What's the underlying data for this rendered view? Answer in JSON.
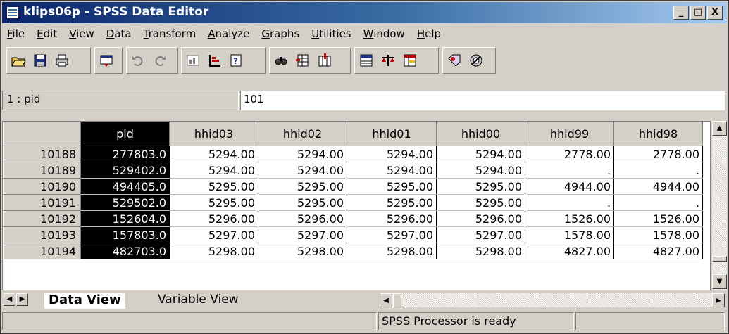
{
  "window": {
    "title": "klips06p - SPSS Data Editor",
    "controls": {
      "minimize": "_",
      "maximize": "□",
      "close": "X"
    }
  },
  "menu": [
    {
      "label": "File",
      "accel": "F",
      "rest": "ile"
    },
    {
      "label": "Edit",
      "accel": "E",
      "rest": "dit"
    },
    {
      "label": "View",
      "accel": "V",
      "rest": "iew"
    },
    {
      "label": "Data",
      "accel": "D",
      "rest": "ata"
    },
    {
      "label": "Transform",
      "accel": "T",
      "rest": "ransform"
    },
    {
      "label": "Analyze",
      "accel": "A",
      "rest": "nalyze"
    },
    {
      "label": "Graphs",
      "accel": "G",
      "rest": "raphs"
    },
    {
      "label": "Utilities",
      "accel": "U",
      "rest": "tilities"
    },
    {
      "label": "Window",
      "accel": "W",
      "rest": "indow"
    },
    {
      "label": "Help",
      "accel": "H",
      "rest": "elp"
    }
  ],
  "toolbar": {
    "icons": [
      "open-icon",
      "save-icon",
      "print-icon",
      "dialog-recall-icon",
      "undo-icon",
      "redo-icon",
      "goto-chart-icon",
      "goto-case-icon",
      "variables-icon",
      "find-icon",
      "insert-case-icon",
      "insert-variable-icon",
      "split-file-icon",
      "weight-cases-icon",
      "select-cases-icon",
      "value-labels-icon",
      "use-sets-icon"
    ]
  },
  "cell_editor": {
    "reference": "1 : pid",
    "value": "101"
  },
  "grid": {
    "columns": [
      "pid",
      "hhid03",
      "hhid02",
      "hhid01",
      "hhid00",
      "hhid99",
      "hhid98"
    ],
    "rows": [
      {
        "row": "10188",
        "cells": [
          "277803.0",
          "5294.00",
          "5294.00",
          "5294.00",
          "5294.00",
          "2778.00",
          "2778.00"
        ]
      },
      {
        "row": "10189",
        "cells": [
          "529402.0",
          "5294.00",
          "5294.00",
          "5294.00",
          "5294.00",
          ".",
          "."
        ]
      },
      {
        "row": "10190",
        "cells": [
          "494405.0",
          "5295.00",
          "5295.00",
          "5295.00",
          "5295.00",
          "4944.00",
          "4944.00"
        ]
      },
      {
        "row": "10191",
        "cells": [
          "529502.0",
          "5295.00",
          "5295.00",
          "5295.00",
          "5295.00",
          ".",
          "."
        ]
      },
      {
        "row": "10192",
        "cells": [
          "152604.0",
          "5296.00",
          "5296.00",
          "5296.00",
          "5296.00",
          "1526.00",
          "1526.00"
        ]
      },
      {
        "row": "10193",
        "cells": [
          "157803.0",
          "5297.00",
          "5297.00",
          "5297.00",
          "5297.00",
          "1578.00",
          "1578.00"
        ]
      },
      {
        "row": "10194",
        "cells": [
          "482703.0",
          "5298.00",
          "5298.00",
          "5298.00",
          "5298.00",
          "4827.00",
          "4827.00"
        ]
      }
    ]
  },
  "tabs": {
    "data_view": "Data View",
    "variable_view": "Variable View"
  },
  "status": {
    "message": "SPSS Processor  is ready"
  }
}
